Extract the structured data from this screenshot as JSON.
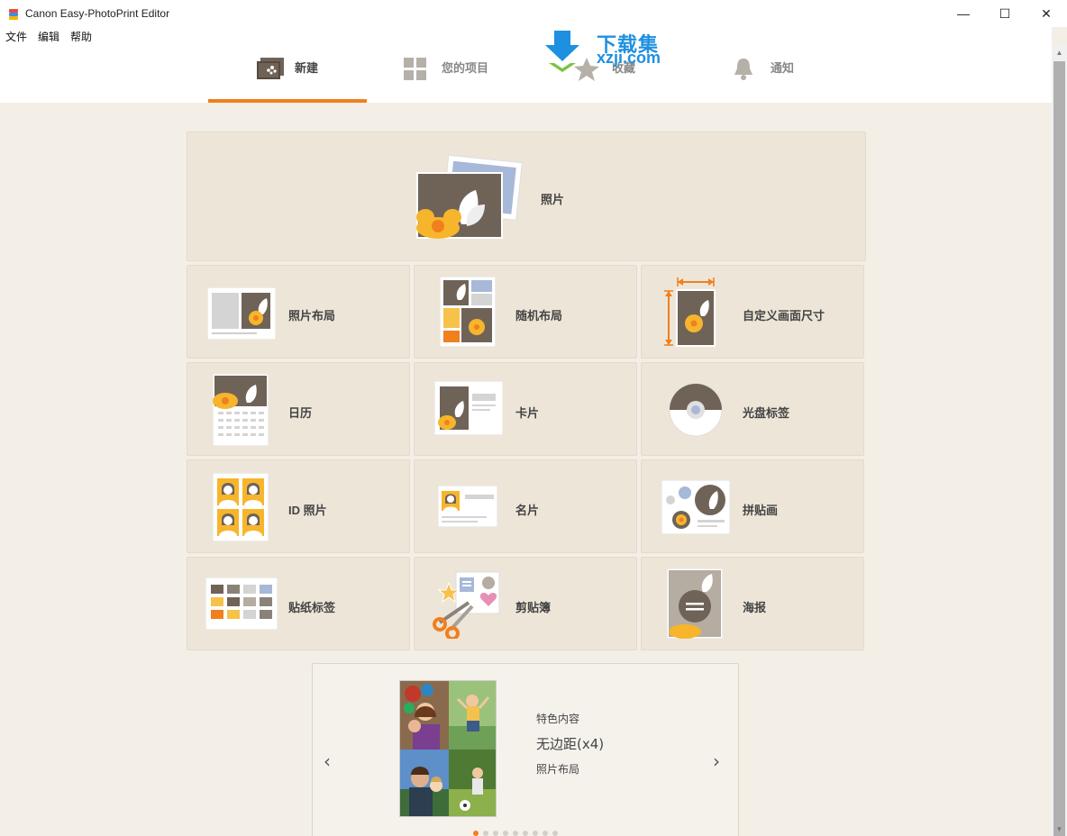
{
  "window": {
    "title": "Canon Easy-PhotoPrint Editor",
    "minimize_glyph": "—",
    "maximize_glyph": "☐",
    "close_glyph": "✕"
  },
  "menu": [
    "文件",
    "编辑",
    "帮助"
  ],
  "tabs": [
    {
      "label": "新建",
      "icon": "new-icon",
      "active": true
    },
    {
      "label": "您的项目",
      "icon": "grid-icon",
      "active": false
    },
    {
      "label": "收藏",
      "icon": "star-icon",
      "active": false
    },
    {
      "label": "通知",
      "icon": "bell-icon",
      "active": false
    }
  ],
  "watermark": {
    "title": "下载集",
    "sub": "xzji.com"
  },
  "cards": [
    {
      "label": "照片",
      "icon": "photo-icon"
    },
    {
      "label": "照片布局",
      "icon": "photo-layout-icon"
    },
    {
      "label": "随机布局",
      "icon": "random-layout-icon"
    },
    {
      "label": "自定义画面尺寸",
      "icon": "custom-size-icon"
    },
    {
      "label": "日历",
      "icon": "calendar-icon"
    },
    {
      "label": "卡片",
      "icon": "card-icon"
    },
    {
      "label": "光盘标签",
      "icon": "disc-label-icon"
    },
    {
      "label": "ID 照片",
      "icon": "id-photo-icon"
    },
    {
      "label": "名片",
      "icon": "business-card-icon"
    },
    {
      "label": "拼贴画",
      "icon": "collage-icon"
    },
    {
      "label": "贴纸标签",
      "icon": "sticker-icon"
    },
    {
      "label": "剪贴簿",
      "icon": "scrapbook-icon"
    },
    {
      "label": "海报",
      "icon": "poster-icon"
    }
  ],
  "featured": {
    "kicker": "特色内容",
    "title": "无边距(x4)",
    "category": "照片布局",
    "prev_glyph": "‹",
    "next_glyph": "›",
    "page_count": 9,
    "active_page": 0
  },
  "colors": {
    "accent": "#f07f1d",
    "card_bg": "#ede6d8",
    "page_bg": "#f3efe6",
    "photo_brown": "#6f6358",
    "flower_yellow": "#f7b52c"
  }
}
